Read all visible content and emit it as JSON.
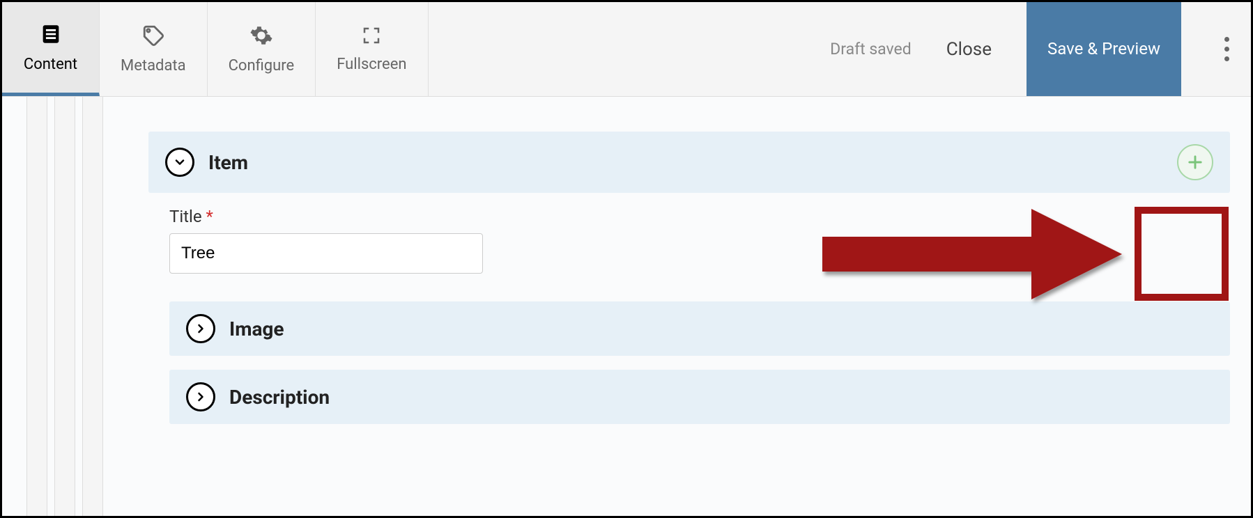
{
  "toolbar": {
    "tabs": [
      {
        "label": "Content",
        "icon": "document"
      },
      {
        "label": "Metadata",
        "icon": "tag"
      },
      {
        "label": "Configure",
        "icon": "gear"
      },
      {
        "label": "Fullscreen",
        "icon": "fullscreen"
      }
    ],
    "status": "Draft saved",
    "close_label": "Close",
    "save_label": "Save & Preview"
  },
  "panels": {
    "item": {
      "title": "Item",
      "fields": {
        "title_label": "Title",
        "title_value": "Tree"
      },
      "subpanels": [
        {
          "title": "Image"
        },
        {
          "title": "Description"
        }
      ]
    }
  }
}
